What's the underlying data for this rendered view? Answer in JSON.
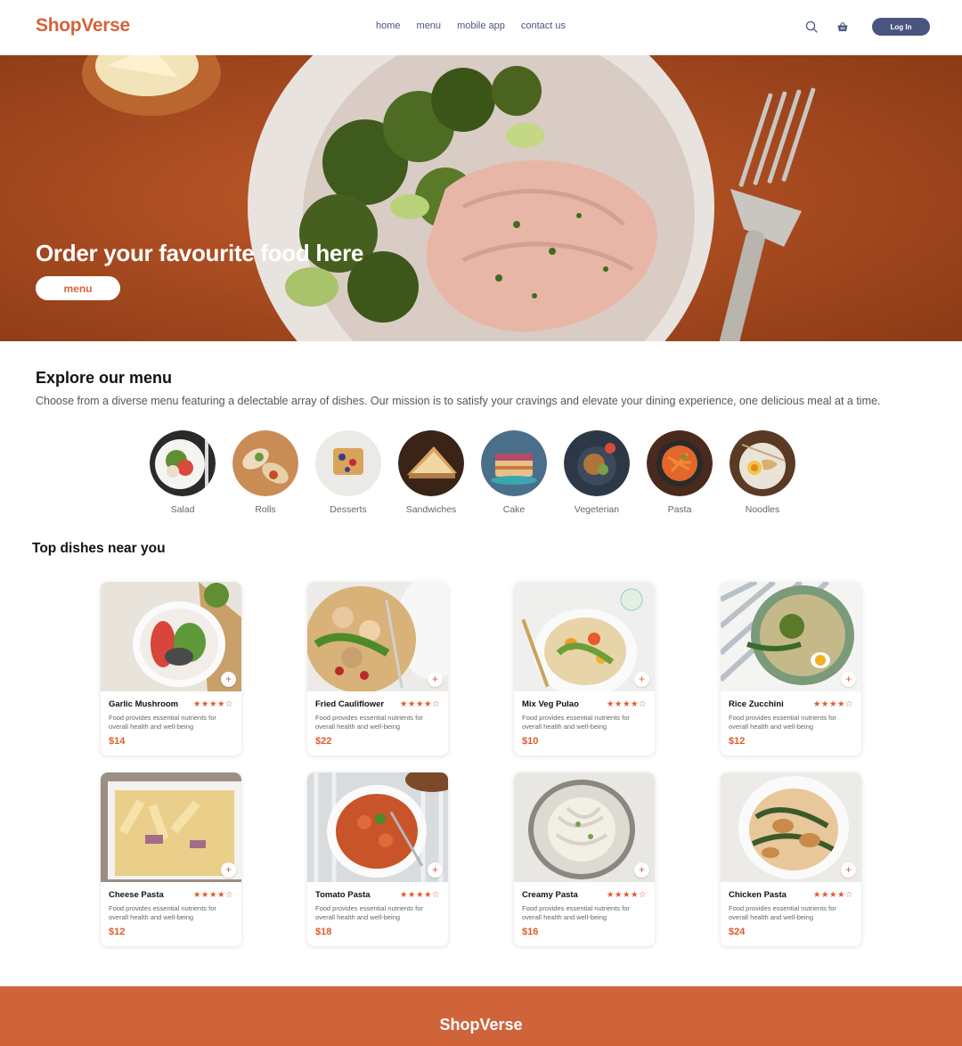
{
  "header": {
    "logo": "ShopVerse",
    "nav": [
      "home",
      "menu",
      "mobile app",
      "contact us"
    ],
    "login_label": "Log In",
    "icons": [
      "search-icon",
      "basket-icon"
    ]
  },
  "hero": {
    "title": "Order your favourite food here",
    "button_label": "menu"
  },
  "explore": {
    "title": "Explore our menu",
    "description": "Choose from a diverse menu featuring a delectable array of dishes. Our mission is to satisfy your cravings and elevate your dining experience, one delicious meal at a time.",
    "categories": [
      "Salad",
      "Rolls",
      "Desserts",
      "Sandwiches",
      "Cake",
      "Vegeterian",
      "Pasta",
      "Noodles"
    ]
  },
  "top_dishes": {
    "title": "Top dishes near you",
    "items": [
      {
        "name": "Garlic Mushroom",
        "rating": 4,
        "stars": "★★★★☆",
        "description": "Food provides essential nutrients for overall health and well-being",
        "price": "$14"
      },
      {
        "name": "Fried Cauliflower",
        "rating": 4,
        "stars": "★★★★☆",
        "description": "Food provides essential nutrients for overall health and well-being",
        "price": "$22"
      },
      {
        "name": "Mix Veg Pulao",
        "rating": 4,
        "stars": "★★★★☆",
        "description": "Food provides essential nutrients for overall health and well-being",
        "price": "$10"
      },
      {
        "name": "Rice Zucchini",
        "rating": 4,
        "stars": "★★★★☆",
        "description": "Food provides essential nutrients for overall health and well-being",
        "price": "$12"
      },
      {
        "name": "Cheese Pasta",
        "rating": 4,
        "stars": "★★★★☆",
        "description": "Food provides essential nutrients for overall health and well-being",
        "price": "$12"
      },
      {
        "name": "Tomato Pasta",
        "rating": 4,
        "stars": "★★★★☆",
        "description": "Food provides essential nutrients for overall health and well-being",
        "price": "$18"
      },
      {
        "name": "Creamy Pasta",
        "rating": 4,
        "stars": "★★★★☆",
        "description": "Food provides essential nutrients for overall health and well-being",
        "price": "$16"
      },
      {
        "name": "Chicken Pasta",
        "rating": 4,
        "stars": "★★★★☆",
        "description": "Food provides essential nutrients for overall health and well-being",
        "price": "$24"
      }
    ],
    "add_label": "+"
  },
  "footer": {
    "logo": "ShopVerse"
  },
  "colors": {
    "brand": "#d3643a",
    "navy": "#49557e",
    "hero_bg": "#a74b22",
    "footer_bg": "#cf643b",
    "price": "#e05a2b"
  }
}
